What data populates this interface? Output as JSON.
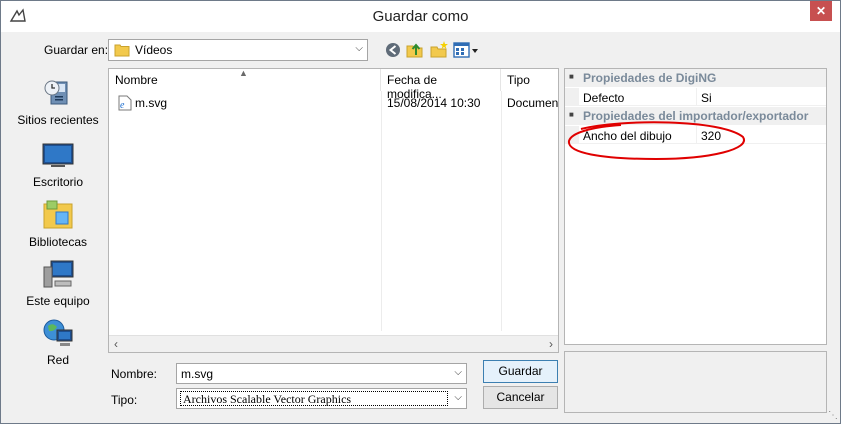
{
  "window": {
    "title": "Guardar como",
    "close_glyph": "✕"
  },
  "toolbar": {
    "save_in_label": "Guardar en:",
    "save_in_value": "Vídeos",
    "icons": [
      "back-icon",
      "up-folder-icon",
      "new-folder-icon",
      "view-menu-icon"
    ]
  },
  "places": [
    {
      "label": "Sitios recientes",
      "icon": "recent-places-icon"
    },
    {
      "label": "Escritorio",
      "icon": "desktop-icon"
    },
    {
      "label": "Bibliotecas",
      "icon": "libraries-icon"
    },
    {
      "label": "Este equipo",
      "icon": "computer-icon"
    },
    {
      "label": "Red",
      "icon": "network-icon"
    }
  ],
  "filelist": {
    "columns": [
      "Nombre",
      "Fecha de modifica...",
      "Tipo"
    ],
    "rows": [
      {
        "name": "m.svg",
        "date": "15/08/2014 10:30",
        "type": "Documen"
      }
    ]
  },
  "propgrid": {
    "categories": [
      {
        "title": "Propiedades de DigiNG",
        "props": [
          {
            "key": "Defecto",
            "value": "Si"
          }
        ]
      },
      {
        "title": "Propiedades del importador/exportador",
        "props": [
          {
            "key": "Ancho del dibujo",
            "value": "320"
          }
        ]
      }
    ]
  },
  "form": {
    "name_label": "Nombre:",
    "name_value": "m.svg",
    "type_label": "Tipo:",
    "type_value": "Archivos Scalable Vector Graphics"
  },
  "buttons": {
    "save": "Guardar",
    "cancel": "Cancelar"
  },
  "colors": {
    "accent": "#3c7fb1",
    "annotation": "#e00000",
    "close": "#c75050"
  }
}
